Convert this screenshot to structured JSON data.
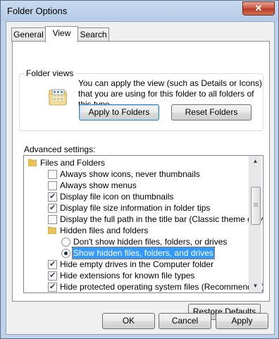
{
  "window": {
    "title": "Folder Options",
    "close_glyph": "✕"
  },
  "tabs": [
    {
      "label": "General"
    },
    {
      "label": "View",
      "active": true
    },
    {
      "label": "Search"
    }
  ],
  "folder_views": {
    "title": "Folder views",
    "description": "You can apply the view (such as Details or Icons) that you are using for this folder to all folders of this type.",
    "apply_button": "Apply to Folders",
    "reset_button": "Reset Folders",
    "icon": "folder-view-icon"
  },
  "advanced": {
    "label": "Advanced settings:",
    "items": [
      {
        "type": "folder",
        "label": "Files and Folders"
      },
      {
        "type": "checkbox",
        "label": "Always show icons, never thumbnails",
        "checked": false
      },
      {
        "type": "checkbox",
        "label": "Always show menus",
        "checked": false
      },
      {
        "type": "checkbox",
        "label": "Display file icon on thumbnails",
        "checked": true
      },
      {
        "type": "checkbox",
        "label": "Display file size information in folder tips",
        "checked": true
      },
      {
        "type": "checkbox",
        "label": "Display the full path in the title bar (Classic theme only)",
        "checked": false
      },
      {
        "type": "folder",
        "label": "Hidden files and folders"
      },
      {
        "type": "radio",
        "label": "Don't show hidden files, folders, or drives",
        "checked": false
      },
      {
        "type": "radio",
        "label": "Show hidden files, folders, and drives",
        "checked": true,
        "selected": true
      },
      {
        "type": "checkbox",
        "label": "Hide empty drives in the Computer folder",
        "checked": true
      },
      {
        "type": "checkbox",
        "label": "Hide extensions for known file types",
        "checked": true
      },
      {
        "type": "checkbox",
        "label": "Hide protected operating system files (Recommended)",
        "checked": true
      }
    ],
    "scroll_up": "▲",
    "scroll_down": "▼",
    "restore_button": "Restore Defaults"
  },
  "footer": {
    "ok": "OK",
    "cancel": "Cancel",
    "apply": "Apply"
  },
  "colors": {
    "selection": "#3399ff",
    "close_red": "#c8513d",
    "title_bg": "#bdd1ea"
  }
}
